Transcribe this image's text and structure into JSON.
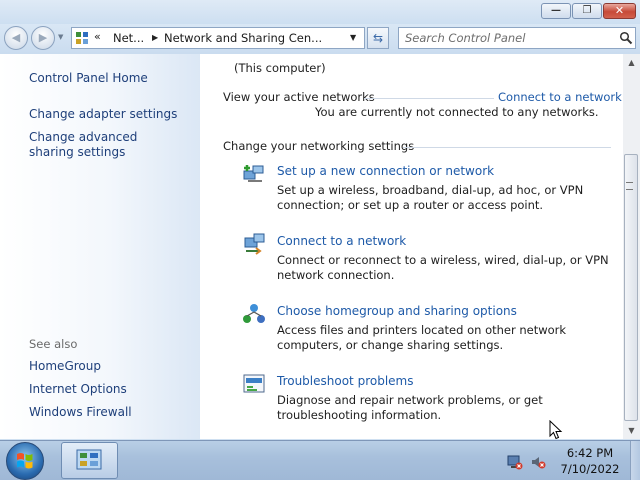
{
  "window": {
    "caption_buttons": {
      "minimize": "—",
      "maximize": "❐",
      "close": "✕"
    }
  },
  "navigation": {
    "back_icon": "back-arrow-icon",
    "forward_icon": "forward-arrow-icon",
    "address": {
      "overflow_chevron": "«",
      "crumbs": [
        "Net...",
        "Network and Sharing Cen..."
      ]
    },
    "search": {
      "placeholder": "Search Control Panel"
    }
  },
  "sidebar": {
    "items": [
      {
        "label": "Control Panel Home"
      },
      {
        "label": "Change adapter settings"
      },
      {
        "label": "Change advanced sharing settings"
      }
    ],
    "see_also": {
      "heading": "See also",
      "items": [
        {
          "label": "HomeGroup"
        },
        {
          "label": "Internet Options"
        },
        {
          "label": "Windows Firewall"
        }
      ]
    }
  },
  "main": {
    "this_computer": "(This computer)",
    "active_networks": {
      "heading": "View your active networks",
      "action": "Connect to a network",
      "status": "You are currently not connected to any networks."
    },
    "settings": {
      "heading": "Change your networking settings",
      "tasks": [
        {
          "title": "Set up a new connection or network",
          "description": "Set up a wireless, broadband, dial-up, ad hoc, or VPN connection; or set up a router or access point.",
          "icon": "new-connection-icon"
        },
        {
          "title": "Connect to a network",
          "description": "Connect or reconnect to a wireless, wired, dial-up, or VPN network connection.",
          "icon": "connect-network-icon"
        },
        {
          "title": "Choose homegroup and sharing options",
          "description": "Access files and printers located on other network computers, or change sharing settings.",
          "icon": "homegroup-icon"
        },
        {
          "title": "Troubleshoot problems",
          "description": "Diagnose and repair network problems, or get troubleshooting information.",
          "icon": "troubleshoot-icon"
        }
      ]
    }
  },
  "taskbar": {
    "clock": {
      "time": "6:42 PM",
      "date": "7/10/2022"
    }
  }
}
